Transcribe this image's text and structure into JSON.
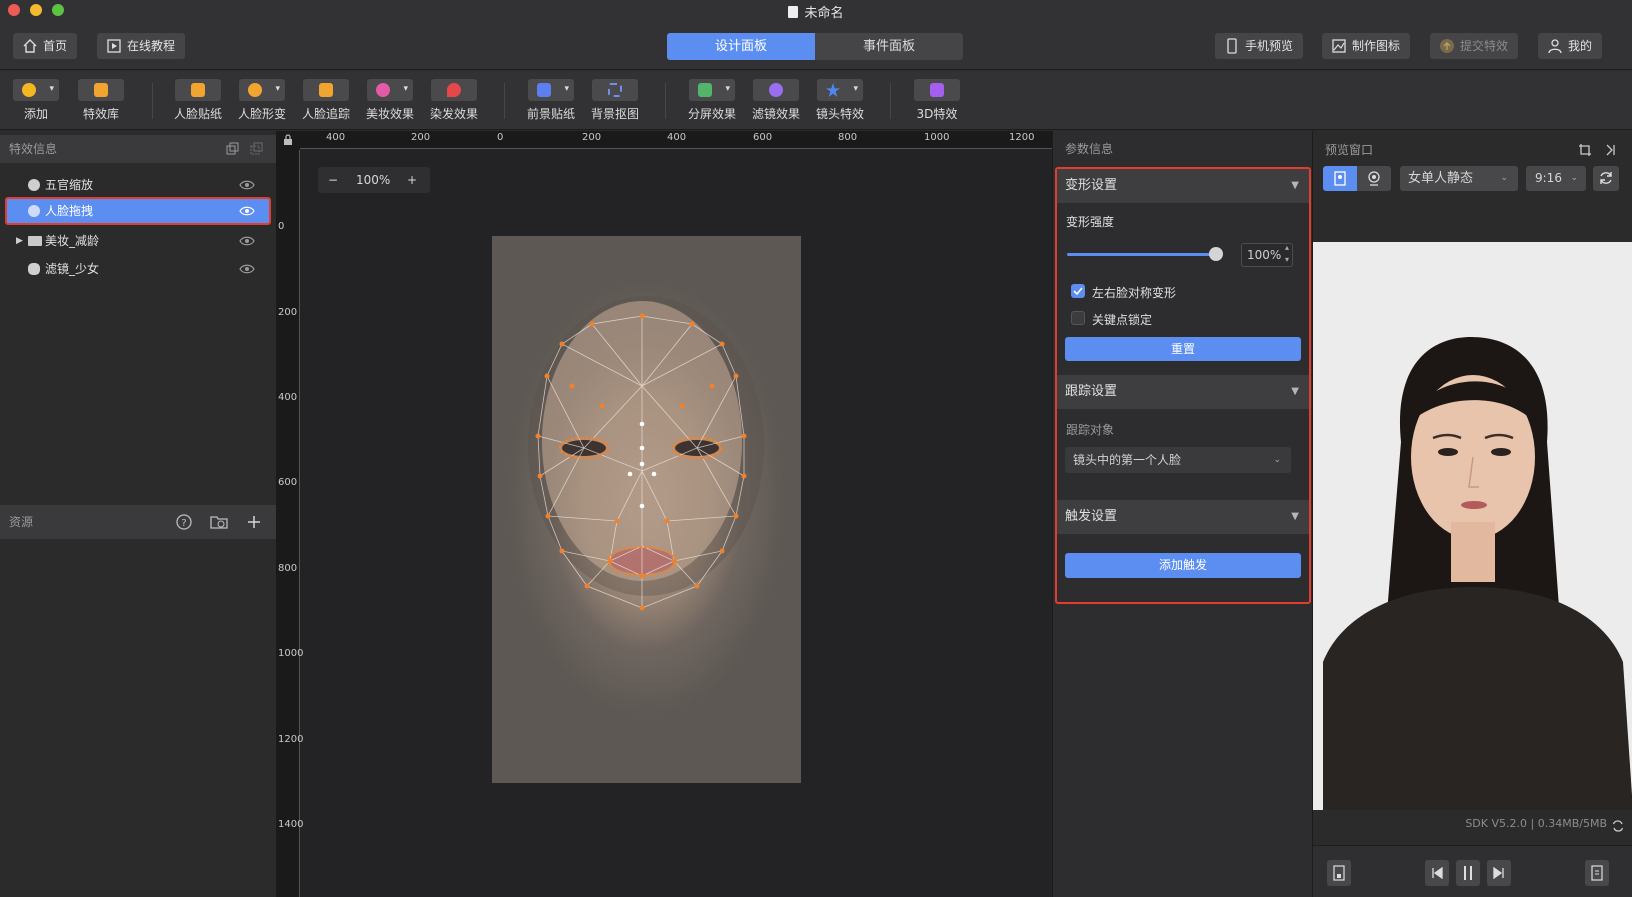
{
  "window": {
    "title": "未命名"
  },
  "nav": {
    "home": "首页",
    "tutorial": "在线教程",
    "tabs": [
      "设计面板",
      "事件面板"
    ],
    "phone_preview": "手机预览",
    "make_icon": "制作图标",
    "submit": "提交特效",
    "mine": "我的"
  },
  "toolbar": {
    "items": [
      "添加",
      "特效库",
      "人脸贴纸",
      "人脸形变",
      "人脸追踪",
      "美妆效果",
      "染发效果",
      "前景贴纸",
      "背景抠图",
      "分屏效果",
      "滤镜效果",
      "镜头特效",
      "3D特效"
    ]
  },
  "effects_panel": {
    "title": "特效信息",
    "layers": [
      "五官缩放",
      "人脸拖拽",
      "美妆_减龄",
      "滤镜_少女"
    ]
  },
  "resources_panel": {
    "title": "资源"
  },
  "canvas": {
    "ruler_top": [
      "400",
      "200",
      "0",
      "200",
      "400",
      "600",
      "800",
      "1000",
      "1200"
    ],
    "ruler_left": [
      "0",
      "200",
      "400",
      "600",
      "800",
      "1000",
      "1200",
      "1400"
    ],
    "zoom": "100%",
    "zoom_minus": "−",
    "zoom_plus": "+"
  },
  "params": {
    "title": "参数信息",
    "deform": {
      "title": "变形设置",
      "strength_label": "变形强度",
      "strength_value": "100%",
      "strength": 1.0,
      "symmetric_label": "左右脸对称变形",
      "symmetric_checked": true,
      "keypoint_lock_label": "关键点锁定",
      "keypoint_lock_checked": false,
      "reset": "重置"
    },
    "tracking": {
      "title": "跟踪设置",
      "target_label": "跟踪对象",
      "target_value": "镜头中的第一个人脸"
    },
    "trigger": {
      "title": "触发设置",
      "add": "添加触发"
    }
  },
  "preview": {
    "title": "预览窗口",
    "model": "女单人静态",
    "ratio": "9:16",
    "sdk": "SDK V5.2.0",
    "size": "0.34MB/5MB"
  },
  "colors": {
    "accent": "#5b8ef0",
    "highlight": "#e23d2d",
    "mesh_point": "#f0822e"
  }
}
